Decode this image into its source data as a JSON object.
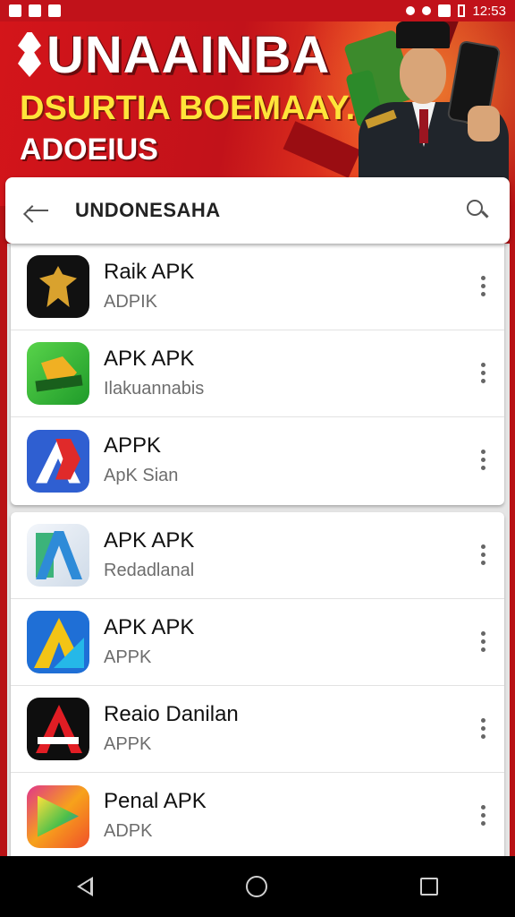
{
  "status_bar": {
    "time": "12:53",
    "left_icons": [
      "flag-icon",
      "notification-icon",
      "app-icon"
    ],
    "right_icons": [
      "bluetooth-icon",
      "wifi-icon",
      "signal-icon",
      "battery-icon"
    ]
  },
  "banner": {
    "title": "UNAAINBA",
    "subtitle": "DSURTIA BOEMAAY.",
    "tagline": "ADOEIUS",
    "colors": {
      "background": "#c2121a",
      "title": "#ffffff",
      "subtitle": "#ffe43a"
    }
  },
  "search": {
    "query": "UNDONESAHA",
    "back_icon": "back-arrow-icon",
    "search_icon": "search-icon"
  },
  "app_list": {
    "group_1": [
      {
        "title": "Raik APK",
        "subtitle": "ADPIK",
        "icon": "garuda-icon"
      },
      {
        "title": "APK APK",
        "subtitle": "Ilakuannabis",
        "icon": "green-app-icon"
      },
      {
        "title": "APPK",
        "subtitle": "ApK Sian",
        "icon": "blue-a-icon"
      }
    ],
    "group_2": [
      {
        "title": "APK APK",
        "subtitle": "Redadlanal",
        "icon": "light-a-icon"
      },
      {
        "title": "APK APK",
        "subtitle": "APPK",
        "icon": "yellow-a-icon"
      },
      {
        "title": "Reaio Danilan",
        "subtitle": "APPK",
        "icon": "red-a-icon"
      },
      {
        "title": "Penal APK",
        "subtitle": "ADPK",
        "icon": "rainbow-play-icon"
      }
    ]
  },
  "nav_bar": {
    "buttons": [
      "nav-back-icon",
      "nav-home-icon",
      "nav-recent-icon"
    ]
  }
}
